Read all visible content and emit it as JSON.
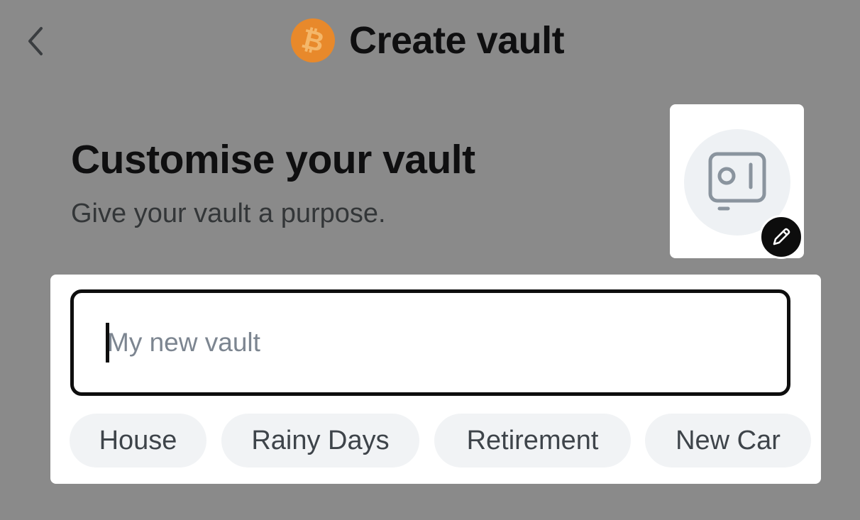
{
  "header": {
    "back_icon": "chevron-left-icon",
    "currency_icon": "bitcoin-icon",
    "currency_symbol": "₿",
    "title": "Create vault"
  },
  "intro": {
    "title": "Customise your vault",
    "subtitle": "Give your vault a purpose."
  },
  "vault_icon": {
    "icon": "safe-icon",
    "edit_icon": "pencil-icon"
  },
  "name_field": {
    "value": "",
    "placeholder": "My new vault"
  },
  "suggestions": [
    {
      "label": "House"
    },
    {
      "label": "Rainy Days"
    },
    {
      "label": "Retirement"
    },
    {
      "label": "New Car"
    }
  ],
  "colors": {
    "backdrop": "#8a8a8a",
    "bitcoin_orange": "#e8892b",
    "text_primary": "#0f0f10",
    "chip_bg": "#f1f3f5"
  }
}
